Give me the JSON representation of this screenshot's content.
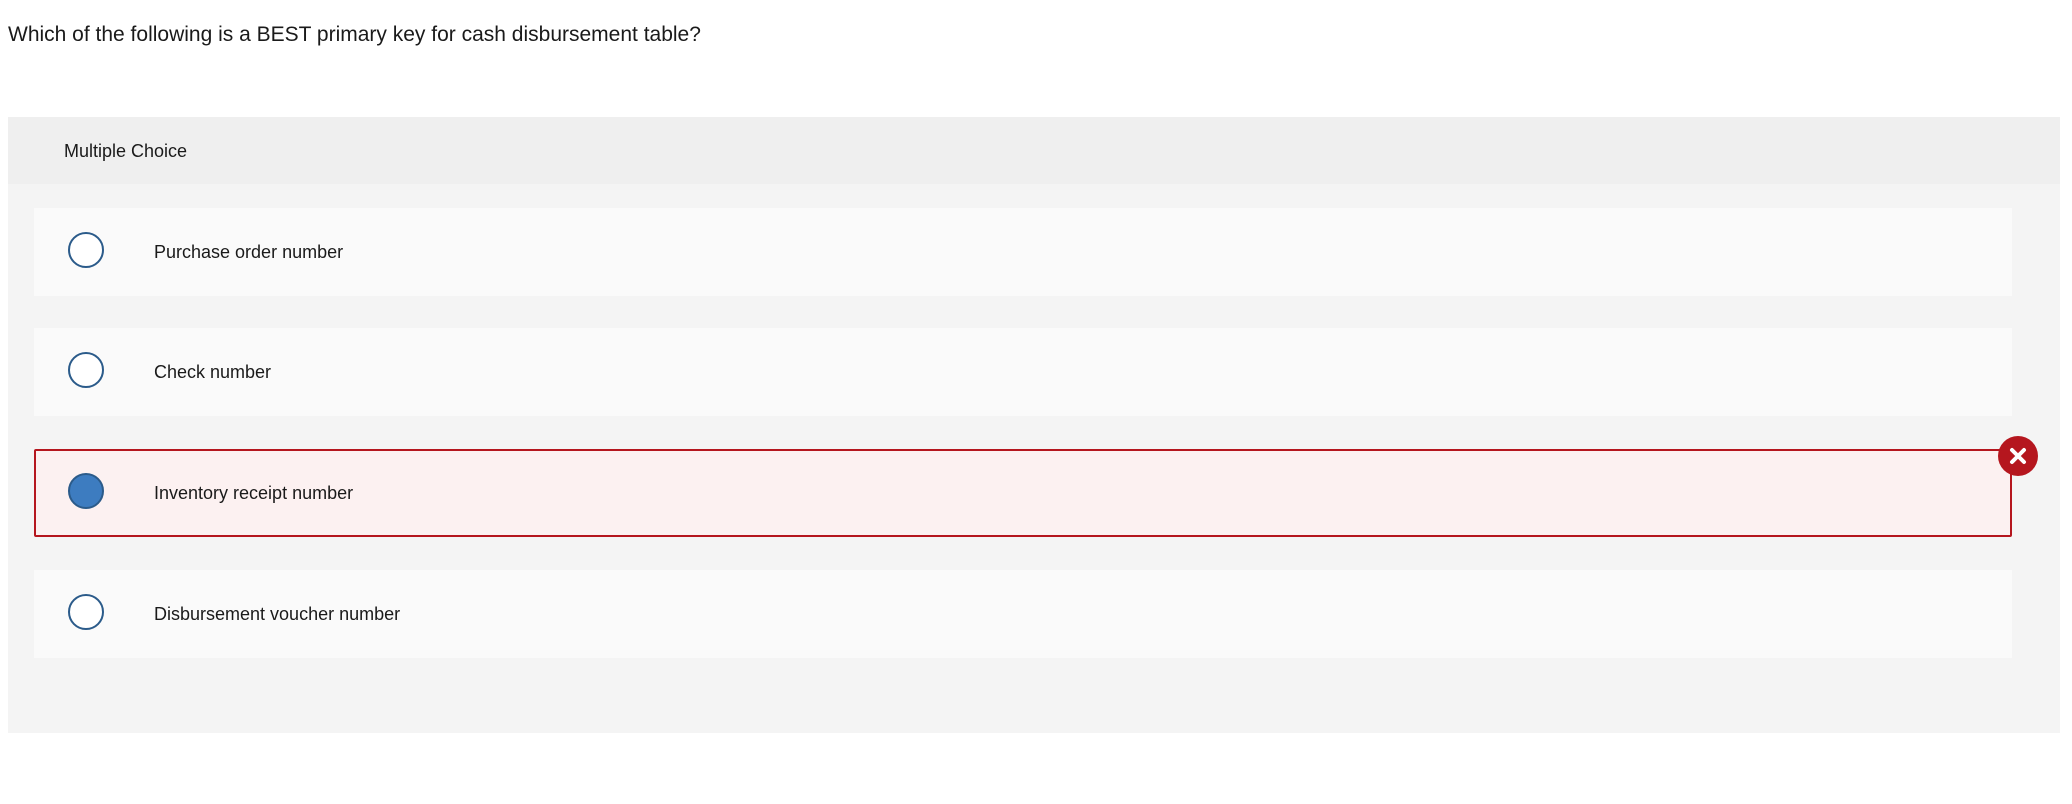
{
  "question": {
    "text": "Which of the following is a BEST primary key for cash disbursement table?"
  },
  "panel": {
    "title": "Multiple Choice"
  },
  "choices": [
    {
      "label": "Purchase order number",
      "selected": false
    },
    {
      "label": "Check number",
      "selected": false
    },
    {
      "label": "Inventory receipt number",
      "selected": true,
      "status": "incorrect"
    },
    {
      "label": "Disbursement voucher number",
      "selected": false
    }
  ],
  "colors": {
    "radio_border": "#2b5b8a",
    "radio_fill_selected": "#3d7cc0",
    "incorrect_accent": "#b5161e",
    "incorrect_background": "#fcf1f1"
  },
  "icons": {
    "incorrect": "close-x-icon"
  }
}
